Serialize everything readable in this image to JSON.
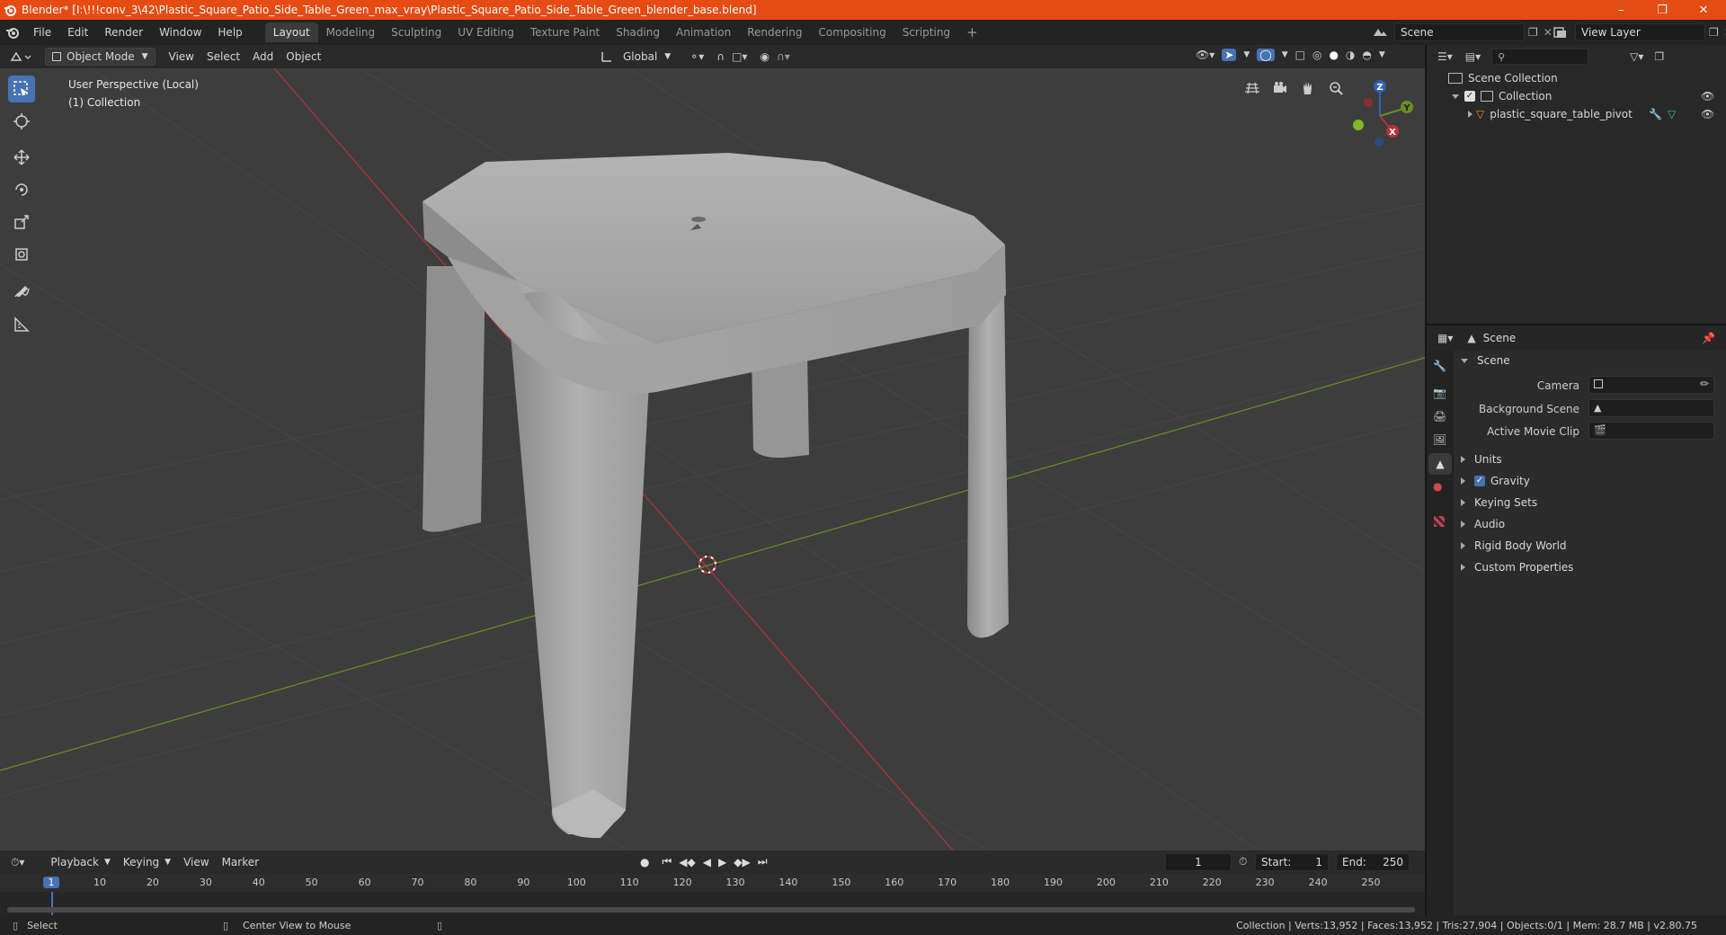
{
  "window": {
    "title": "Blender* [I:\\!!!conv_3\\42\\Plastic_Square_Patio_Side_Table_Green_max_vray\\Plastic_Square_Patio_Side_Table_Green_blender_base.blend]"
  },
  "menus": [
    "File",
    "Edit",
    "Render",
    "Window",
    "Help"
  ],
  "workspaces": [
    "Layout",
    "Modeling",
    "Sculpting",
    "UV Editing",
    "Texture Paint",
    "Shading",
    "Animation",
    "Rendering",
    "Compositing",
    "Scripting"
  ],
  "active_workspace": "Layout",
  "scene_field": "Scene",
  "view_layer_field": "View Layer",
  "viewport_header": {
    "mode": "Object Mode",
    "menus": [
      "View",
      "Select",
      "Add",
      "Object"
    ],
    "orientation": "Global"
  },
  "viewport": {
    "perspective": "User Perspective (Local)",
    "collection": "(1) Collection"
  },
  "gizmo": {
    "x": "X",
    "y": "Y",
    "z": "Z"
  },
  "outliner": {
    "scene_collection": "Scene Collection",
    "collection": "Collection",
    "object": "plastic_square_table_pivot"
  },
  "properties": {
    "header": "Scene",
    "section": "Scene",
    "camera_label": "Camera",
    "background_label": "Background Scene",
    "movie_clip_label": "Active Movie Clip",
    "panels": [
      "Units",
      "Gravity",
      "Keying Sets",
      "Audio",
      "Rigid Body World",
      "Custom Properties"
    ],
    "gravity_checked": true
  },
  "timeline": {
    "menus": [
      "Playback",
      "Keying",
      "View",
      "Marker"
    ],
    "current_frame": "1",
    "start_label": "Start:",
    "start": "1",
    "end_label": "End:",
    "end": "250",
    "ticks": [
      "1",
      "10",
      "20",
      "30",
      "40",
      "50",
      "60",
      "70",
      "80",
      "90",
      "100",
      "110",
      "120",
      "130",
      "140",
      "150",
      "160",
      "170",
      "180",
      "190",
      "200",
      "210",
      "220",
      "230",
      "240",
      "250"
    ]
  },
  "status": {
    "select": "Select",
    "center": "Center View to Mouse",
    "stats": "Collection | Verts:13,952 | Faces:13,952 | Tris:27,904 | Objects:0/1 | Mem: 28.7 MB | v2.80.75"
  },
  "colors": {
    "titlebar": "#e64b13",
    "active_tool": "#4772b3",
    "axis_x": "#b8323a",
    "axis_y": "#6c8e23",
    "frame_current": "#4772b3",
    "viewport_bg": "#3d3d3d"
  },
  "icons": [
    "blender-logo-icon",
    "select-box-icon",
    "cursor-icon",
    "move-icon",
    "rotate-icon",
    "scale-icon",
    "transform-icon",
    "annotate-icon",
    "measure-icon",
    "grid-toggle-icon",
    "camera-view-icon",
    "hand-pan-icon",
    "zoom-icon",
    "eye-icon",
    "wrench-icon",
    "mesh-icon"
  ]
}
